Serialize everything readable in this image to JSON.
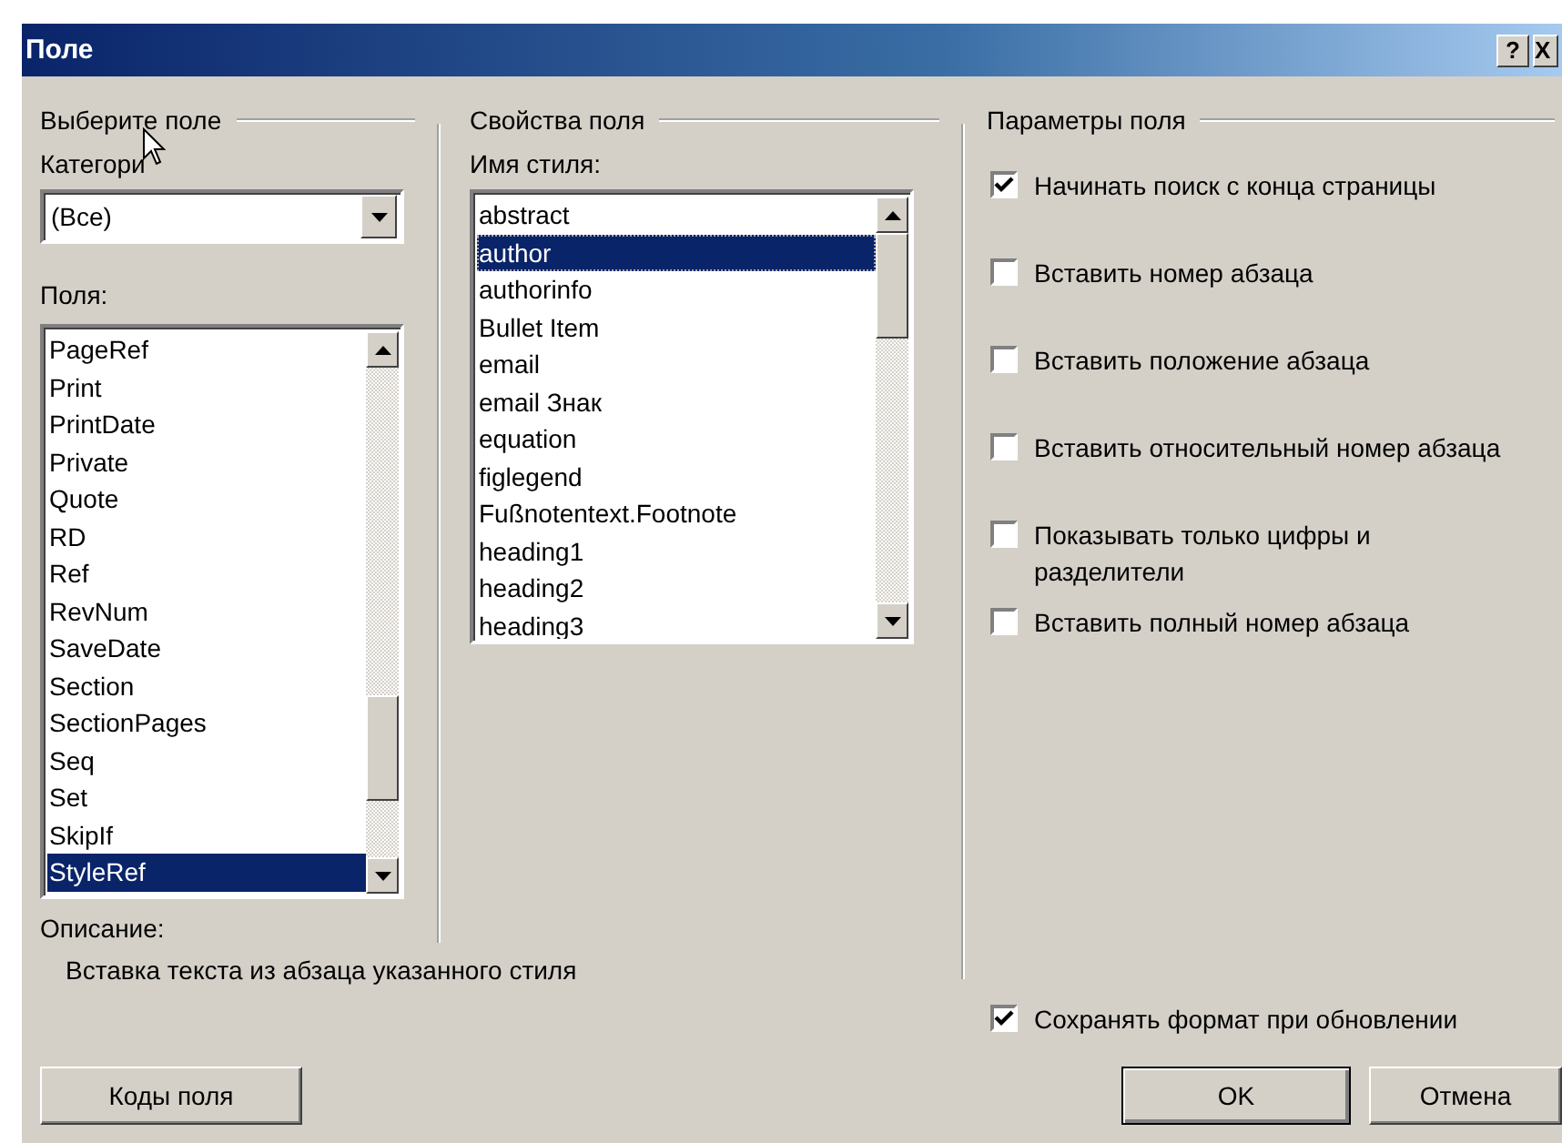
{
  "window": {
    "title": "Поле",
    "help_button": "?",
    "close_button": "X"
  },
  "choose_field": {
    "heading": "Выберите поле",
    "category_label": "Категори",
    "category_value": "(Все)",
    "fields_label": "Поля:",
    "fields": [
      {
        "label": "PageRef",
        "selected": false
      },
      {
        "label": "Print",
        "selected": false
      },
      {
        "label": "PrintDate",
        "selected": false
      },
      {
        "label": "Private",
        "selected": false
      },
      {
        "label": "Quote",
        "selected": false
      },
      {
        "label": "RD",
        "selected": false
      },
      {
        "label": "Ref",
        "selected": false
      },
      {
        "label": "RevNum",
        "selected": false
      },
      {
        "label": "SaveDate",
        "selected": false
      },
      {
        "label": "Section",
        "selected": false
      },
      {
        "label": "SectionPages",
        "selected": false
      },
      {
        "label": "Seq",
        "selected": false
      },
      {
        "label": "Set",
        "selected": false
      },
      {
        "label": "SkipIf",
        "selected": false
      },
      {
        "label": "StyleRef",
        "selected": true
      }
    ],
    "description_label": "Описание:",
    "description": "Вставка текста из абзаца указанного стиля"
  },
  "field_properties": {
    "heading": "Свойства поля",
    "style_label": "Имя стиля:",
    "styles": [
      {
        "label": "abstract",
        "selected": false
      },
      {
        "label": "author",
        "selected": true
      },
      {
        "label": "authorinfo",
        "selected": false
      },
      {
        "label": "Bullet Item",
        "selected": false
      },
      {
        "label": "email",
        "selected": false
      },
      {
        "label": "email Знак",
        "selected": false
      },
      {
        "label": "equation",
        "selected": false
      },
      {
        "label": "figlegend",
        "selected": false
      },
      {
        "label": "Fußnotentext.Footnote",
        "selected": false
      },
      {
        "label": "heading1",
        "selected": false
      },
      {
        "label": "heading2",
        "selected": false
      },
      {
        "label": "heading3",
        "selected": false
      }
    ]
  },
  "field_options": {
    "heading": "Параметры поля",
    "options": [
      {
        "label": "Начинать поиск с конца страницы",
        "checked": true
      },
      {
        "label": "Вставить номер абзаца",
        "checked": false
      },
      {
        "label": "Вставить положение абзаца",
        "checked": false
      },
      {
        "label": "Вставить относительный номер абзаца",
        "checked": false
      },
      {
        "label": "Показывать только цифры и разделители",
        "checked": false
      },
      {
        "label": "Вставить полный номер абзаца",
        "checked": false
      }
    ],
    "preserve_format": {
      "label": "Сохранять формат при обновлении",
      "checked": true
    }
  },
  "buttons": {
    "field_codes": "Коды поля",
    "ok": "OK",
    "cancel": "Отмена"
  }
}
